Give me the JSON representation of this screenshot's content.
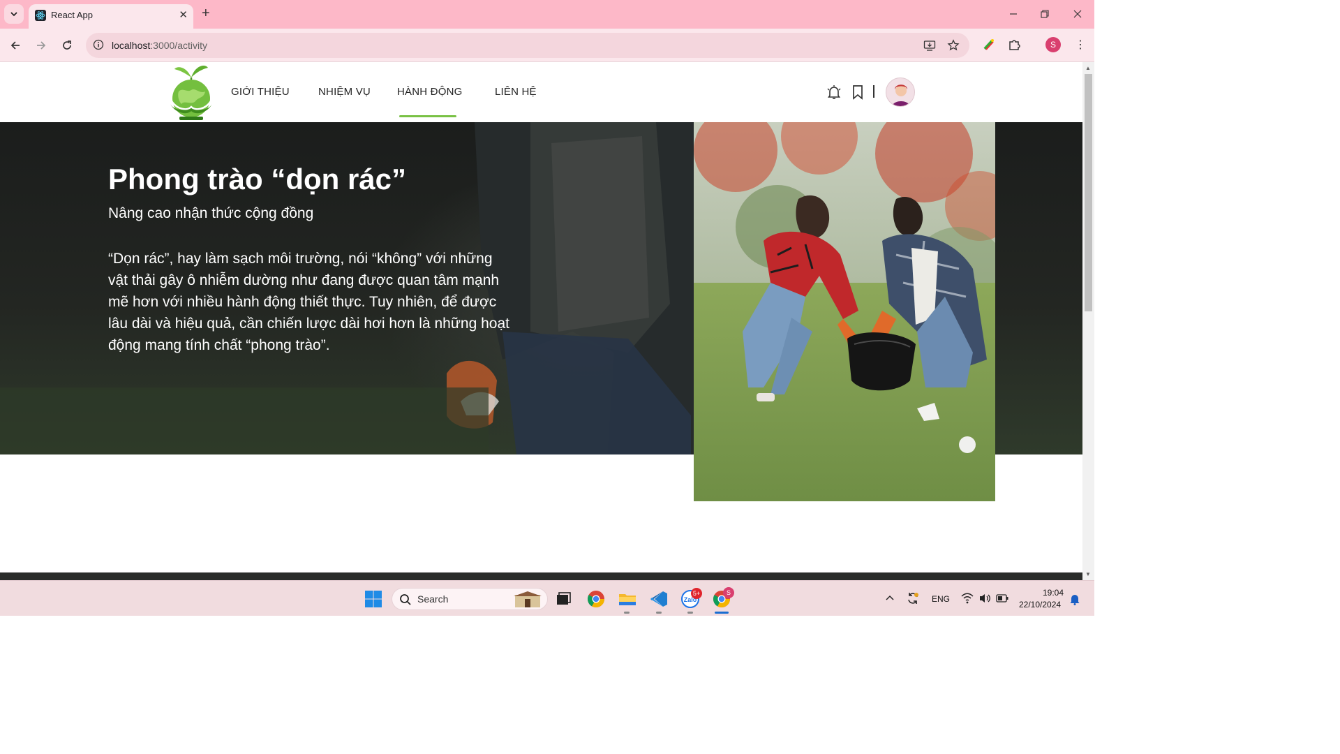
{
  "browser": {
    "tab_title": "React App",
    "url_host": "localhost",
    "url_path": ":3000/activity",
    "profile_initial": "S"
  },
  "site": {
    "nav": [
      {
        "label": "GIỚI THIỆU"
      },
      {
        "label": "NHIỆM VỤ"
      },
      {
        "label": "HÀNH ĐỘNG"
      },
      {
        "label": "LIÊN HỆ"
      }
    ],
    "active_nav": "HÀNH ĐỘNG",
    "accent_color": "#79c144"
  },
  "hero": {
    "title": "Phong trào “dọn rác”",
    "subtitle": "Nâng cao nhận thức cộng đồng",
    "body": "“Dọn rác”, hay làm sạch môi trường, nói “không” với những vật thải gây ô nhiễm dường như đang được quan tâm mạnh mẽ hơn với nhiều hành động thiết thực. Tuy nhiên, để được lâu dài và hiệu quả, cần chiến lược dài hơi hơn là những hoạt động mang tính chất “phong trào”."
  },
  "taskbar": {
    "search_label": "Search",
    "zalo_badge": "5+",
    "chrome_badge": "S",
    "language": "ENG",
    "time": "19:04",
    "date": "22/10/2024"
  },
  "icons": [
    "dropdown-icon",
    "react-icon",
    "close-icon",
    "plus-icon",
    "minimize-icon",
    "restore-icon",
    "back-icon",
    "forward-icon",
    "reload-icon",
    "info-icon",
    "install-icon",
    "star-icon",
    "extension-icon",
    "puzzle-icon",
    "menu-icon",
    "bell-icon",
    "bookmark-icon",
    "windows-icon",
    "search-icon",
    "task-view-icon",
    "chrome-icon",
    "folder-icon",
    "vscode-icon",
    "zalo-icon",
    "chevron-up-icon",
    "sync-icon",
    "wifi-icon",
    "volume-icon",
    "battery-icon",
    "notification-icon"
  ]
}
